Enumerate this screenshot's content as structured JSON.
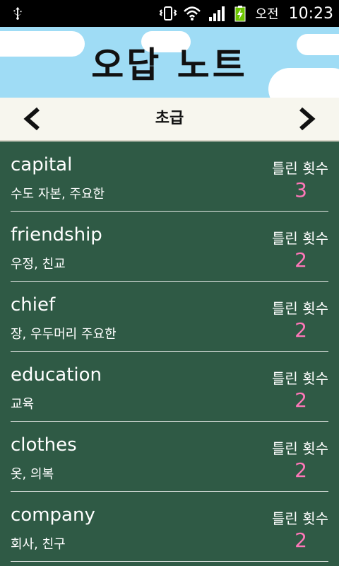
{
  "status": {
    "ampm": "오전",
    "time": "10:23"
  },
  "header": {
    "title": "오답 노트"
  },
  "nav": {
    "title": "초급"
  },
  "list": {
    "label": "틀린 횟수",
    "items": [
      {
        "word": "capital",
        "meaning": "수도 자본, 주요한",
        "count": "3"
      },
      {
        "word": "friendship",
        "meaning": "우정, 친교",
        "count": "2"
      },
      {
        "word": "chief",
        "meaning": "장, 우두머리 주요한",
        "count": "2"
      },
      {
        "word": "education",
        "meaning": "교육",
        "count": "2"
      },
      {
        "word": "clothes",
        "meaning": "옷, 의복",
        "count": "2"
      },
      {
        "word": "company",
        "meaning": "회사, 친구",
        "count": "2"
      }
    ]
  },
  "colors": {
    "background": "#2f5a45",
    "header_sky": "#9fdcf5",
    "count_pink": "#ff77b9"
  }
}
